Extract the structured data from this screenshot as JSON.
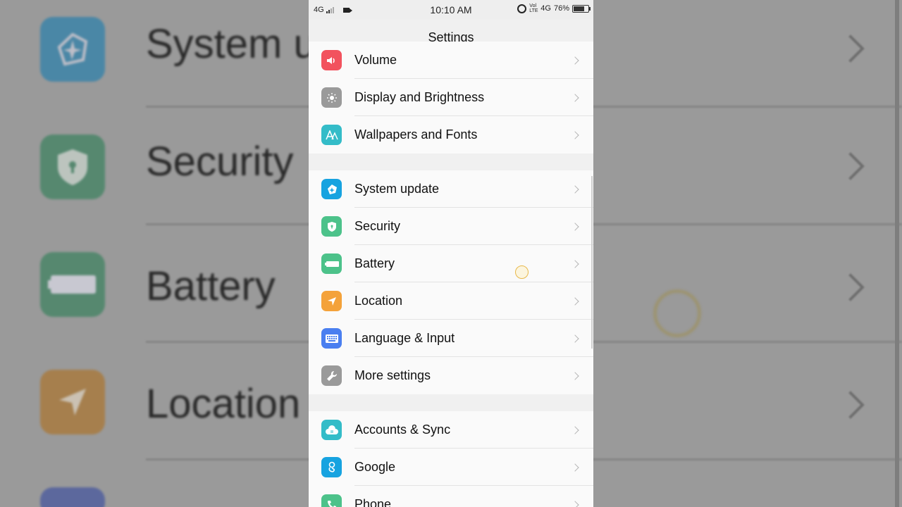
{
  "background": {
    "rows": [
      {
        "label": "System u",
        "icon": "system-update-icon",
        "color": "#0a78b0"
      },
      {
        "label": "Security",
        "icon": "shield-icon",
        "color": "#1f7a4d"
      },
      {
        "label": "Battery",
        "icon": "battery-icon",
        "color": "#1f7a4d"
      },
      {
        "label": "Location",
        "icon": "location-arrow-icon",
        "color": "#b06a10"
      }
    ]
  },
  "statusbar": {
    "network_left": "4G",
    "time": "10:10 AM",
    "volte": "Vol LTE",
    "network_right": "4G",
    "battery_percent": "76%",
    "battery_level": 0.76
  },
  "header": {
    "title": "Settings"
  },
  "groups": [
    {
      "items": [
        {
          "label": "Volume",
          "icon": "volume-icon",
          "color": "#f2525e"
        },
        {
          "label": "Display and Brightness",
          "icon": "brightness-icon",
          "color": "#9a9a9a"
        },
        {
          "label": "Wallpapers and Fonts",
          "icon": "font-icon",
          "color": "#34bcc8"
        }
      ]
    },
    {
      "items": [
        {
          "label": "System update",
          "icon": "system-update-icon",
          "color": "#17a3e0"
        },
        {
          "label": "Security",
          "icon": "shield-icon",
          "color": "#4cc28a"
        },
        {
          "label": "Battery",
          "icon": "battery-icon",
          "color": "#4cc28a"
        },
        {
          "label": "Location",
          "icon": "location-arrow-icon",
          "color": "#f4a23a"
        },
        {
          "label": "Language & Input",
          "icon": "keyboard-icon",
          "color": "#4a7ff0"
        },
        {
          "label": "More settings",
          "icon": "wrench-icon",
          "color": "#9a9a9a"
        }
      ]
    },
    {
      "items": [
        {
          "label": "Accounts & Sync",
          "icon": "cloud-sync-icon",
          "color": "#34bcc8"
        },
        {
          "label": "Google",
          "icon": "google-icon",
          "color": "#17a3e0"
        },
        {
          "label": "Phone",
          "icon": "phone-icon",
          "color": "#4cc28a"
        }
      ]
    }
  ]
}
